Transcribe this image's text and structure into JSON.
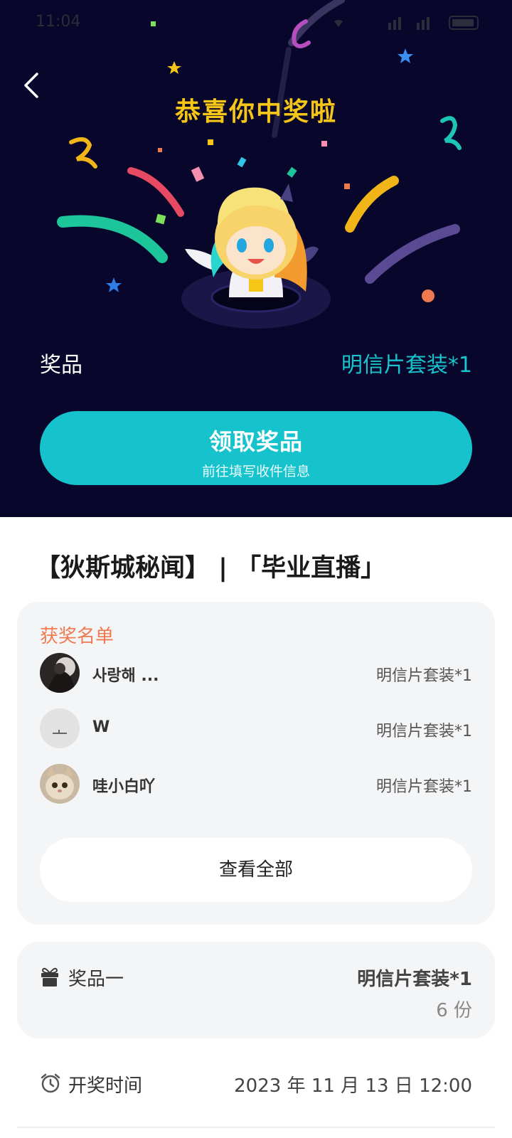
{
  "status_bar": {
    "time": "11:04"
  },
  "hero": {
    "title": "恭喜你中奖啦",
    "prize_label": "奖品",
    "prize_value": "明信片套装*1",
    "claim_button": {
      "title": "领取奖品",
      "subtitle": "前往填写收件信息"
    },
    "colors": {
      "background": "#08062a",
      "title": "#f5c518",
      "accent": "#16c2cc"
    }
  },
  "event": {
    "title": "【狄斯城秘闻】 | 「毕业直播」"
  },
  "winners": {
    "heading": "获奖名单",
    "list": [
      {
        "name": "사랑해 ...",
        "prize": "明信片套装*1",
        "avatar": "dark-portrait"
      },
      {
        "name": "W",
        "prize": "明信片套装*1",
        "avatar": "grey-sky"
      },
      {
        "name": "哇小白吖",
        "prize": "明信片套装*1",
        "avatar": "cat"
      }
    ],
    "view_all_label": "查看全部"
  },
  "prize_info": {
    "icon": "gift-icon",
    "label": "奖品一",
    "value": "明信片套装*1",
    "quantity": "6 份"
  },
  "draw_time": {
    "icon": "alarm-clock-icon",
    "label": "开奖时间",
    "value": "2023 年 11 月 13 日 12:00"
  }
}
